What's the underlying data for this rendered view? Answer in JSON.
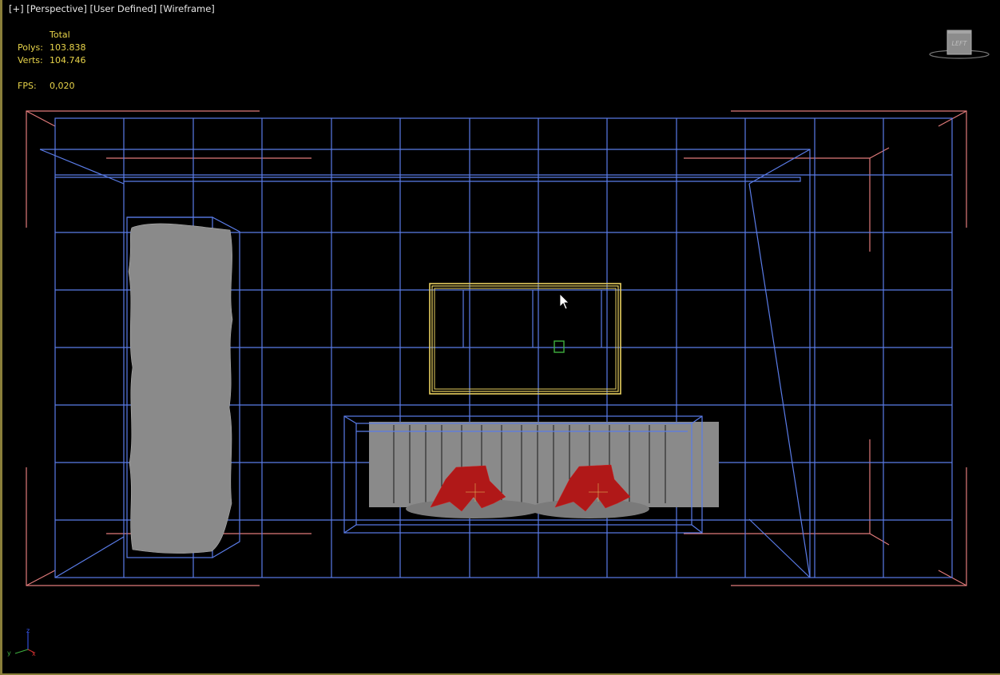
{
  "viewport": {
    "label_parts": [
      "[+]",
      "[Perspective]",
      "[User Defined]",
      "[Wireframe]"
    ]
  },
  "stats": {
    "header": "Total",
    "polys_label": "Polys:",
    "polys_value": "103.838",
    "verts_label": "Verts:",
    "verts_value": "104.746",
    "fps_label": "FPS:",
    "fps_value": "0,020"
  },
  "axis_tripod": {
    "x": "x",
    "y": "y",
    "z": "z"
  },
  "colors": {
    "grid": "#5a7ce8",
    "frame": "#e07a7a",
    "selection": "#e8d060",
    "plant": "#8a8a8a",
    "fire": "#b01818",
    "stats_text": "#e8d44a"
  },
  "viewcube_icon": "viewcube-icon",
  "cursor_icon": "cursor-arrow-icon"
}
